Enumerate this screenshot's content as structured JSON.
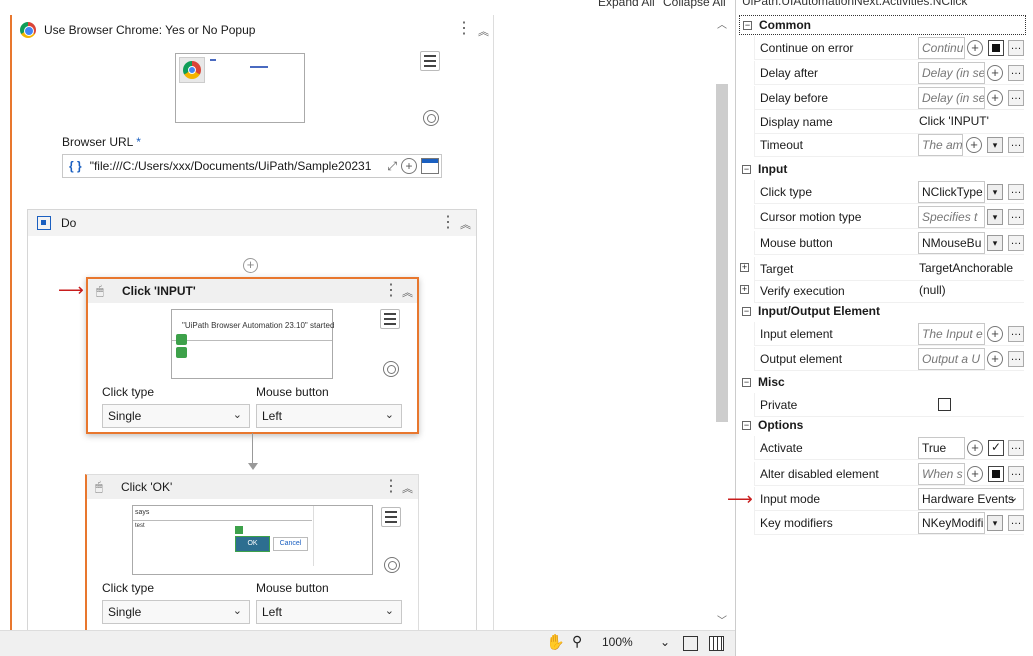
{
  "toolbar": {
    "expand_all": "Expand All",
    "collapse_all": "Collapse All"
  },
  "use_browser": {
    "title": "Use Browser Chrome: Yes or No Popup",
    "url_label": "Browser URL",
    "url_required": "*",
    "url_value": "\"file:///C:/Users/xxx/Documents/UiPath/Sample20231"
  },
  "do": {
    "title": "Do"
  },
  "click_input": {
    "title": "Click 'INPUT'",
    "preview_text": "\"UiPath Browser Automation 23.10\" started",
    "click_type_label": "Click type",
    "click_type_value": "Single",
    "mouse_button_label": "Mouse button",
    "mouse_button_value": "Left"
  },
  "click_ok": {
    "title": "Click 'OK'",
    "preview_says": "says",
    "preview_line": "test",
    "preview_ok": "OK",
    "preview_cancel": "Cancel",
    "click_type_label": "Click type",
    "click_type_value": "Single",
    "mouse_button_label": "Mouse button",
    "mouse_button_value": "Left"
  },
  "status": {
    "zoom": "100%"
  },
  "props": {
    "title": "UiPath.UIAutomationNext.Activities.NClick",
    "categories": {
      "common": "Common",
      "input": "Input",
      "io_element": "Input/Output Element",
      "misc": "Misc",
      "options": "Options"
    },
    "rows": {
      "continue_on_error": {
        "name": "Continue on error",
        "value": "Continu"
      },
      "delay_after": {
        "name": "Delay after",
        "value": "Delay (in se"
      },
      "delay_before": {
        "name": "Delay before",
        "value": "Delay (in se"
      },
      "display_name": {
        "name": "Display name",
        "value": "Click 'INPUT'"
      },
      "timeout": {
        "name": "Timeout",
        "value": "The am"
      },
      "click_type": {
        "name": "Click type",
        "value": "NClickType"
      },
      "cursor_motion": {
        "name": "Cursor motion type",
        "value": "Specifies t"
      },
      "mouse_button": {
        "name": "Mouse button",
        "value": "NMouseBu"
      },
      "target": {
        "name": "Target",
        "value": "TargetAnchorable"
      },
      "verify_execution": {
        "name": "Verify execution",
        "value": "(null)"
      },
      "input_element": {
        "name": "Input element",
        "value": "The Input e"
      },
      "output_element": {
        "name": "Output element",
        "value": "Output a U"
      },
      "private": {
        "name": "Private"
      },
      "activate": {
        "name": "Activate",
        "value": "True"
      },
      "alter_disabled": {
        "name": "Alter disabled element",
        "value": "When s"
      },
      "input_mode": {
        "name": "Input mode",
        "value": "Hardware Events"
      },
      "key_modifiers": {
        "name": "Key modifiers",
        "value": "NKeyModifi"
      }
    }
  },
  "colors": {
    "accent": "#e8772e",
    "annotation_arrow": "#c81d1d",
    "link_blue": "#1a5fc0"
  }
}
